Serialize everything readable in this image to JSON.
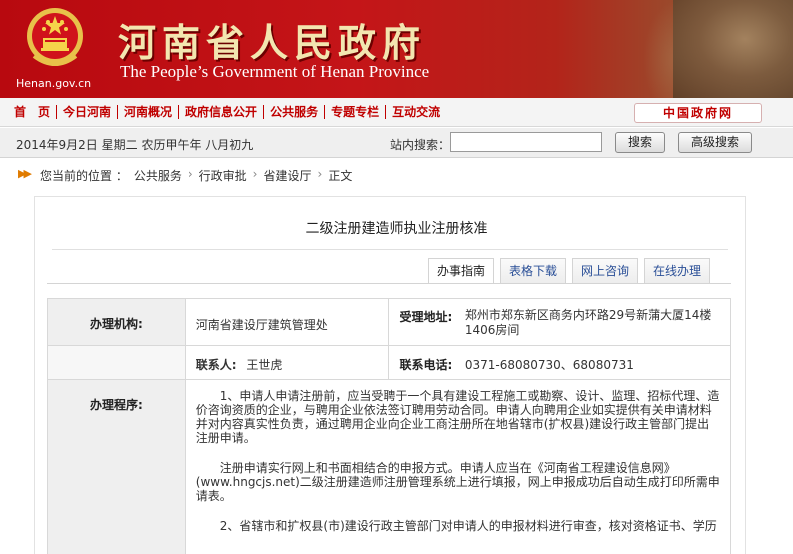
{
  "header": {
    "title_cn": "河南省人民政府",
    "title_en": "The People’s Government of Henan Province",
    "site_domain": "Henan.gov.cn"
  },
  "nav": {
    "items": [
      "首　页",
      "今日河南",
      "河南概况",
      "政府信息公开",
      "公共服务",
      "专题专栏",
      "互动交流"
    ],
    "gov_link": "中国政府网"
  },
  "topbar": {
    "date": "2014年9月2日  星期二  农历甲午年  八月初九",
    "search_label": "站内搜索：",
    "search_value": "",
    "search_button": "搜索",
    "advanced_search_button": "高级搜索"
  },
  "breadcrumb": {
    "prefix": "您当前的位置 ：",
    "items": [
      "公共服务",
      "行政审批",
      "省建设厅",
      "正文"
    ]
  },
  "article": {
    "title": "二级注册建造师执业注册核准"
  },
  "tabs": [
    "办事指南",
    "表格下载",
    "网上咨询",
    "在线办理"
  ],
  "info": {
    "org_label": "办理机构:",
    "org_value": "河南省建设厅建筑管理处",
    "addr_label": "受理地址:",
    "addr_value": "郑州市郑东新区商务内环路29号新蒲大厦14楼1406房间",
    "contact_label": "联系人:",
    "contact_value": "王世虎",
    "phone_label": "联系电话:",
    "phone_value": "0371-68080730、68080731",
    "proc_label": "办理程序:",
    "proc_p1": "1、申请人申请注册前，应当受聘于一个具有建设工程施工或勘察、设计、监理、招标代理、造价咨询资质的企业，与聘用企业依法签订聘用劳动合同。申请人向聘用企业如实提供有关申请材料并对内容真实性负责，通过聘用企业向企业工商注册所在地省辖市(扩权县)建设行政主管部门提出注册申请。",
    "proc_p2": "注册申请实行网上和书面相结合的申报方式。申请人应当在《河南省工程建设信息网》(www.hngcjs.net)二级注册建造师注册管理系统上进行填报，网上申报成功后自动生成打印所需申请表。",
    "proc_p3": "2、省辖市和扩权县(市)建设行政主管部门对申请人的申报材料进行审查，核对资格证书、学历"
  },
  "colors": {
    "brand_red": "#c00000",
    "link_blue": "#2a4f97"
  }
}
